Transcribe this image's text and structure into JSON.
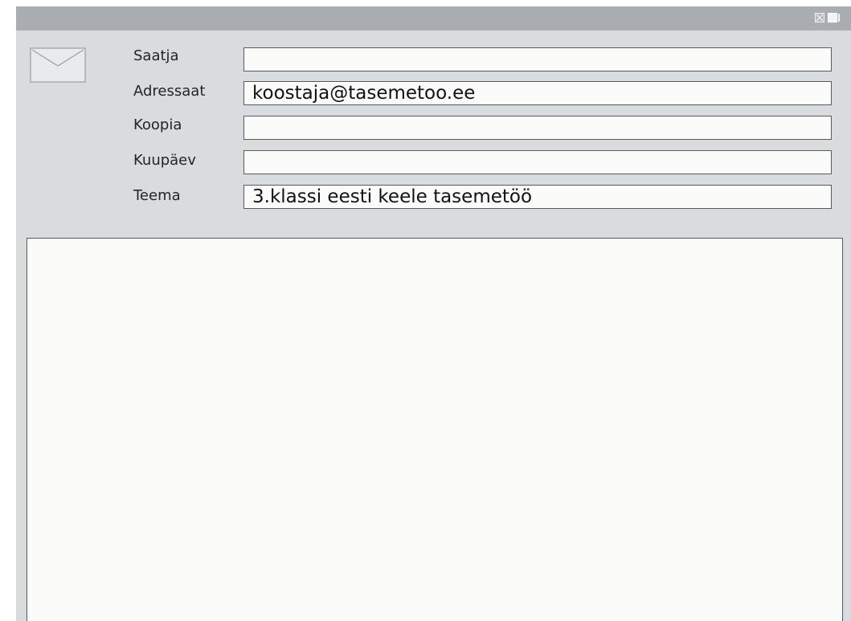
{
  "window": {
    "titlebar_buttons": [
      "close-icon",
      "maximize-icon"
    ]
  },
  "header": {
    "icon": "envelope-icon",
    "fields": [
      {
        "label": "Saatja",
        "value": ""
      },
      {
        "label": "Adressaat",
        "value": "koostaja@tasemetoo.ee"
      },
      {
        "label": "Koopia",
        "value": ""
      },
      {
        "label": "Kuupäev",
        "value": ""
      },
      {
        "label": "Teema",
        "value": "3.klassi eesti keele tasemetöö"
      }
    ]
  },
  "message": {
    "body": ""
  },
  "colors": {
    "titlebar": "#a9adb1",
    "window_bg": "#d9dcdf",
    "field_bg": "#fbfbfa",
    "field_border": "#555a60"
  }
}
